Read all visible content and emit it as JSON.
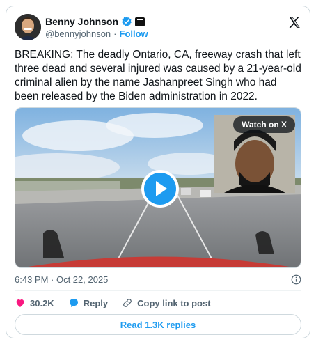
{
  "author": {
    "name": "Benny Johnson",
    "handle": "@bennyjohnson",
    "separator": "·",
    "follow_label": "Follow"
  },
  "tweet": {
    "text": "BREAKING: The deadly Ontario, CA, freeway crash that left three dead and several injured was caused by a 21-year-old criminal alien by the name Jashanpreet Singh who had been released by the Biden administration in 2022.",
    "timestamp": "6:43 PM · Oct 22, 2025"
  },
  "media": {
    "watch_label": "Watch on X"
  },
  "actions": {
    "likes_count": "30.2K",
    "reply_label": "Reply",
    "copy_link_label": "Copy link to post"
  },
  "read_replies_label": "Read 1.3K replies",
  "colors": {
    "accent": "#1d9bf0",
    "like": "#f91880",
    "secondary_text": "#536471",
    "border": "#cfd9de"
  },
  "icons": [
    "verified-badge-icon",
    "affiliation-icon",
    "x-logo-icon",
    "play-icon",
    "info-icon",
    "heart-icon",
    "reply-icon",
    "link-icon"
  ]
}
